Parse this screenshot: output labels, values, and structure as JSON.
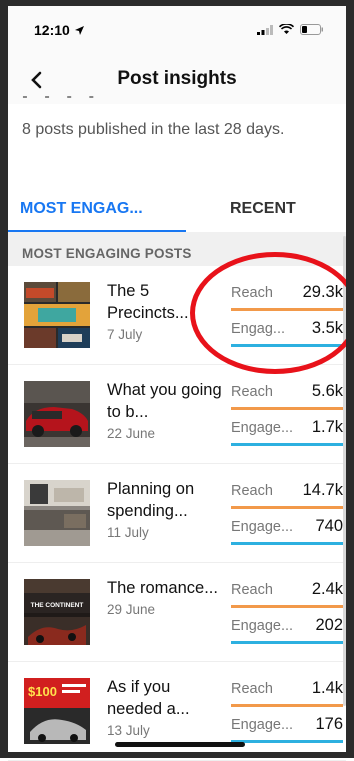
{
  "status_bar": {
    "time": "12:10"
  },
  "nav": {
    "title": "Post insights"
  },
  "summary": "8 posts published in the last 28 days.",
  "tabs": [
    {
      "label": "MOST ENGAG...",
      "active": true
    },
    {
      "label": "RECENT",
      "active": false
    }
  ],
  "section_title": "MOST ENGAGING POSTS",
  "posts": [
    {
      "title": "The 5 Precincts...",
      "date": "7 July",
      "reach_label": "Reach",
      "reach": "29.3k",
      "engagement_label": "Engag...",
      "engagement": "3.5k"
    },
    {
      "title": "What you going to b...",
      "date": "22 June",
      "reach_label": "Reach",
      "reach": "5.6k",
      "engagement_label": "Engage...",
      "engagement": "1.7k"
    },
    {
      "title": "Planning on spending...",
      "date": "11 July",
      "reach_label": "Reach",
      "reach": "14.7k",
      "engagement_label": "Engage...",
      "engagement": "740"
    },
    {
      "title": "The romance...",
      "date": "29 June",
      "reach_label": "Reach",
      "reach": "2.4k",
      "engagement_label": "Engage...",
      "engagement": "202"
    },
    {
      "title": "As if you needed a...",
      "date": "13 July",
      "reach_label": "Reach",
      "reach": "1.4k",
      "engagement_label": "Engage...",
      "engagement": "176"
    }
  ],
  "thumbnails": {
    "post_2": "THE CONTINENT",
    "post_4": "$100"
  },
  "colors": {
    "accent": "#1877f2",
    "reach_bar": "#f2994a",
    "engagement_bar": "#2db0e0",
    "annotation": "#e8121a"
  }
}
